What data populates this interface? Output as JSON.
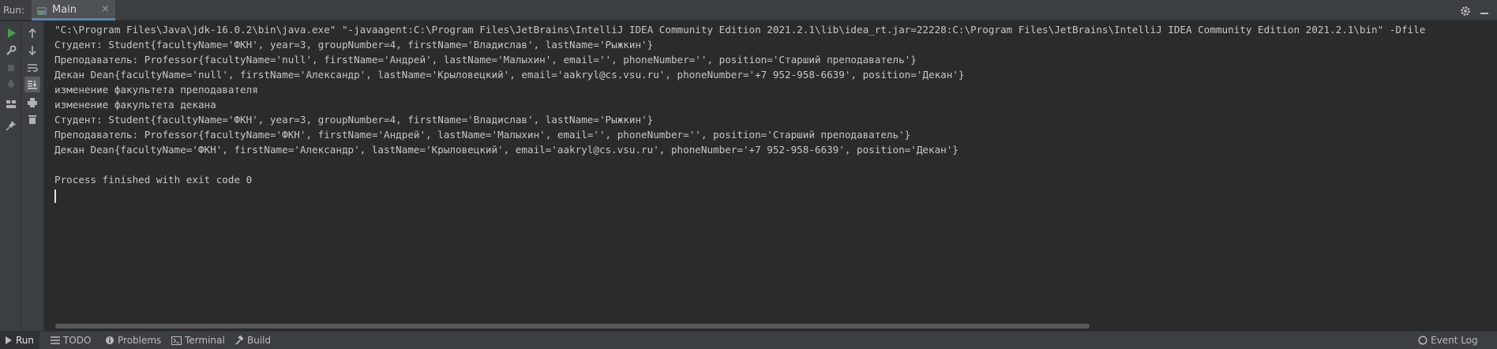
{
  "top_bar": {
    "run_label": "Run:",
    "tab_label": "Main",
    "tab_close": "×"
  },
  "icons": {
    "settings": "gear-icon",
    "minimize": "minimize-icon",
    "run": "run-icon",
    "wrench": "wrench-icon",
    "stop": "stop-icon",
    "debug": "debug-icon",
    "layout": "layout-icon",
    "pin": "pin-icon",
    "up": "arrow-up-icon",
    "down": "arrow-down-icon",
    "wrap": "soft-wrap-icon",
    "scroll_end": "scroll-to-end-icon",
    "print": "print-icon",
    "trash": "trash-icon"
  },
  "console": {
    "lines": [
      "\"C:\\Program Files\\Java\\jdk-16.0.2\\bin\\java.exe\" \"-javaagent:C:\\Program Files\\JetBrains\\IntelliJ IDEA Community Edition 2021.2.1\\lib\\idea_rt.jar=22228:C:\\Program Files\\JetBrains\\IntelliJ IDEA Community Edition 2021.2.1\\bin\" -Dfile",
      "Студент: Student{facultyName='ФКН', year=3, groupNumber=4, firstName='Владислав', lastName='Рыжкин'}",
      "Преподаватель: Professor{facultyName='null', firstName='Андрей', lastName='Малыхин', email='', phoneNumber='', position='Старший преподаватель'}",
      "Декан Dean{facultyName='null', firstName='Александр', lastName='Крыловецкий', email='aakryl@cs.vsu.ru', phoneNumber='+7 952-958-6639', position='Декан'}",
      "изменение факультета преподавателя",
      "изменение факультета декана",
      "Студент: Student{facultyName='ФКН', year=3, groupNumber=4, firstName='Владислав', lastName='Рыжкин'}",
      "Преподаватель: Professor{facultyName='ФКН', firstName='Андрей', lastName='Малыхин', email='', phoneNumber='', position='Старший преподаватель'}",
      "Декан Dean{facultyName='ФКН', firstName='Александр', lastName='Крыловецкий', email='aakryl@cs.vsu.ru', phoneNumber='+7 952-958-6639', position='Декан'}",
      "",
      "Process finished with exit code 0"
    ]
  },
  "bottom_bar": {
    "run": "Run",
    "todo": "TODO",
    "problems": "Problems",
    "terminal": "Terminal",
    "build": "Build",
    "event_log": "Event Log"
  },
  "colors": {
    "background": "#2b2b2b",
    "toolbar": "#3c3f41",
    "accent": "#4a88c7",
    "run_green": "#499c54"
  }
}
